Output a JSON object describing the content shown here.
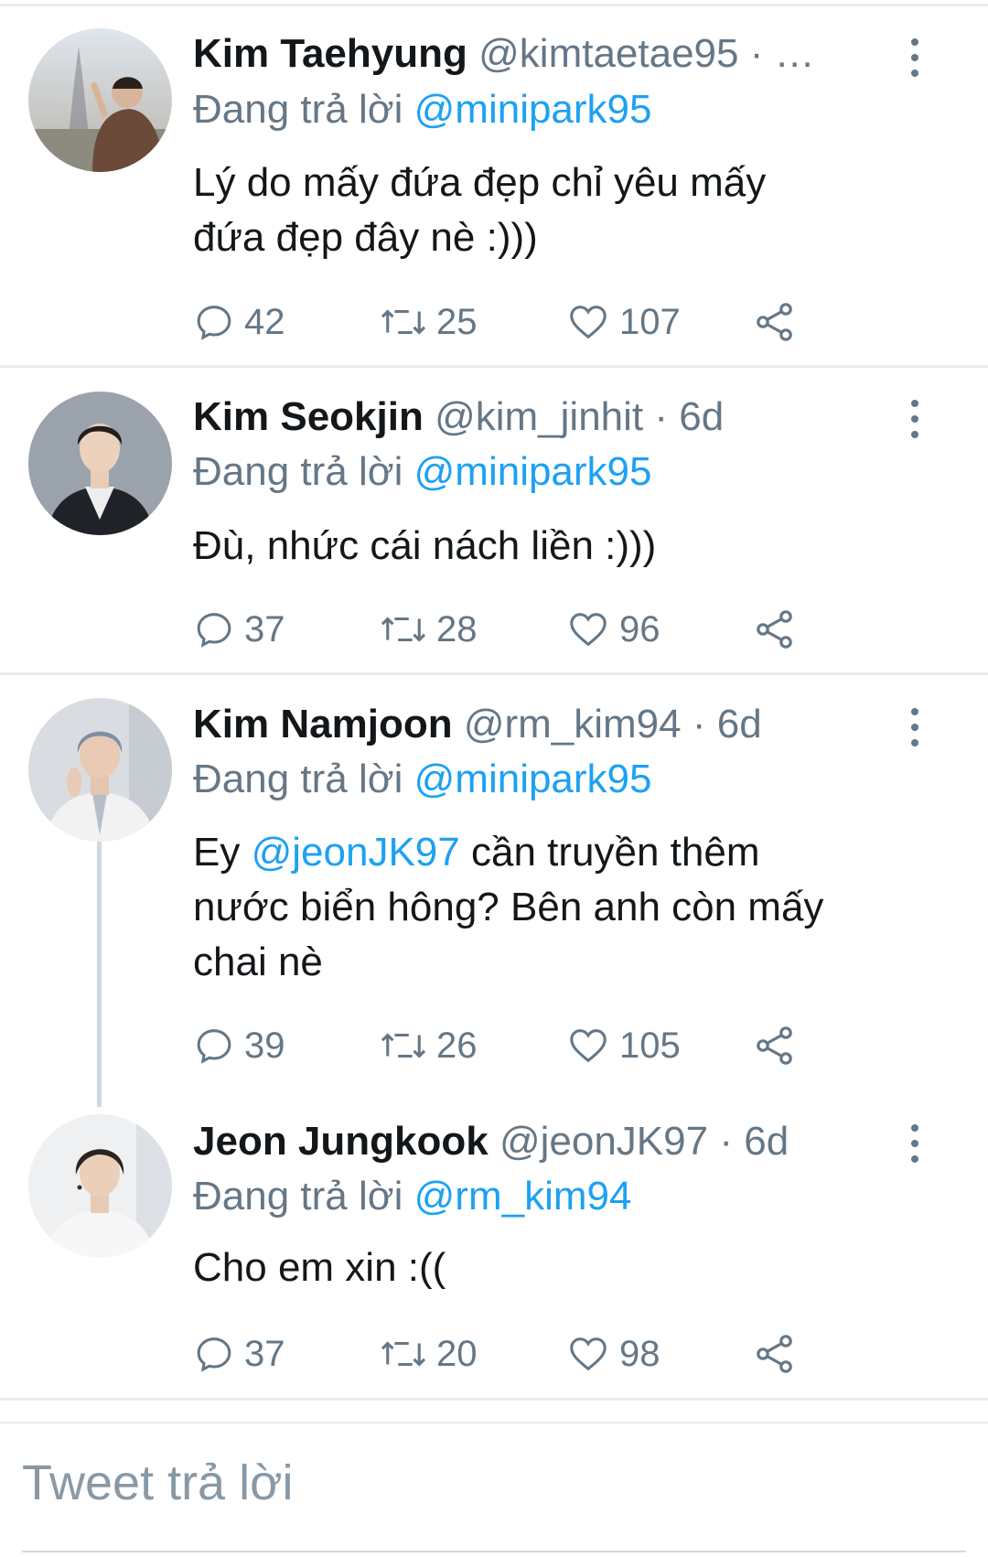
{
  "tweets": [
    {
      "name": "Kim Taehyung",
      "handle": "@kimtaetae95",
      "dot": "·",
      "time": "…",
      "reply_prefix": "Đang trả lời",
      "reply_to": "@minipark95",
      "text_lines": [
        "Lý do mấy đứa đẹp chỉ yêu mấy",
        "đứa đẹp đây nè :)))"
      ],
      "replies": "42",
      "retweets": "25",
      "likes": "107"
    },
    {
      "name": "Kim Seokjin",
      "handle": "@kim_jinhit",
      "dot": "·",
      "time": "6d",
      "reply_prefix": "Đang trả lời",
      "reply_to": "@minipark95",
      "text_lines": [
        "Đù, nhức cái nách liền :)))"
      ],
      "replies": "37",
      "retweets": "28",
      "likes": "96"
    },
    {
      "name": "Kim Namjoon",
      "handle": "@rm_kim94",
      "dot": "·",
      "time": "6d",
      "reply_prefix": "Đang trả lời",
      "reply_to": "@minipark95",
      "text_start": "Ey",
      "text_mention": "@jeonJK97",
      "text_rest_line1": "cần truyền thêm",
      "text_lines_after": [
        "nước biển hông? Bên anh còn mấy",
        "chai nè"
      ],
      "replies": "39",
      "retweets": "26",
      "likes": "105"
    },
    {
      "name": "Jeon Jungkook",
      "handle": "@jeonJK97",
      "dot": "·",
      "time": "6d",
      "reply_prefix": "Đang trả lời",
      "reply_to": "@rm_kim94",
      "text_lines": [
        "Cho em xin :(("
      ],
      "replies": "37",
      "retweets": "20",
      "likes": "98"
    }
  ],
  "compose": {
    "placeholder": "Tweet trả lời"
  },
  "colors": {
    "accent": "#1da1f2",
    "muted": "#657786",
    "divider": "#e6ecf0"
  }
}
